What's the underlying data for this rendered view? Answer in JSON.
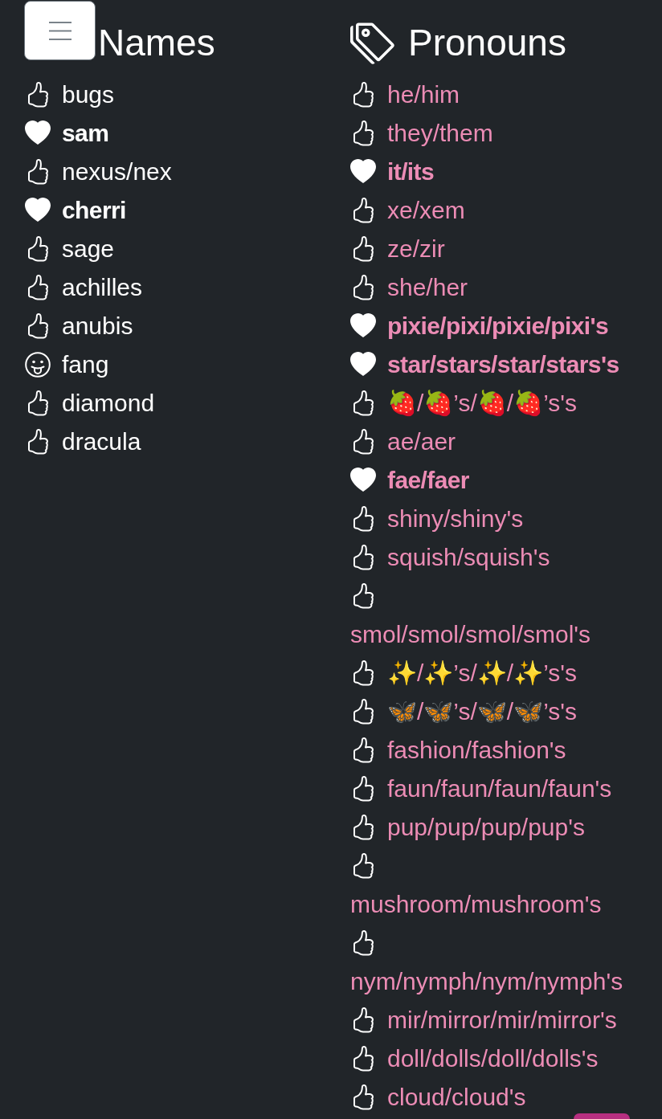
{
  "names": {
    "title": "Names",
    "items": [
      {
        "text": "bugs",
        "kind": "okay"
      },
      {
        "text": "sam",
        "kind": "love"
      },
      {
        "text": "nexus/nex",
        "kind": "okay"
      },
      {
        "text": "cherri",
        "kind": "love"
      },
      {
        "text": "sage",
        "kind": "okay"
      },
      {
        "text": "achilles",
        "kind": "okay"
      },
      {
        "text": "anubis",
        "kind": "okay"
      },
      {
        "text": "fang",
        "kind": "jokingly"
      },
      {
        "text": "diamond",
        "kind": "okay"
      },
      {
        "text": "dracula",
        "kind": "okay"
      }
    ]
  },
  "pronouns": {
    "title": "Pronouns",
    "items": [
      {
        "text": "he/him",
        "kind": "okay"
      },
      {
        "text": "they/them",
        "kind": "okay"
      },
      {
        "text": "it/its",
        "kind": "love"
      },
      {
        "text": "xe/xem",
        "kind": "okay"
      },
      {
        "text": "ze/zir",
        "kind": "okay"
      },
      {
        "text": "she/her",
        "kind": "okay"
      },
      {
        "text": "pixie/pixi/pixie/pixi's",
        "kind": "love"
      },
      {
        "text": "star/stars/star/stars's",
        "kind": "love"
      },
      {
        "text": "🍓/🍓’s/🍓/🍓’s's",
        "kind": "okay"
      },
      {
        "text": "ae/aer",
        "kind": "okay"
      },
      {
        "text": "fae/faer",
        "kind": "love"
      },
      {
        "text": "shiny/shiny's",
        "kind": "okay"
      },
      {
        "text": "squish/squish's",
        "kind": "okay"
      },
      {
        "text": "smol/smol/smol/smol's",
        "kind": "okay"
      },
      {
        "text": "✨/✨’s/✨/✨’s's",
        "kind": "okay"
      },
      {
        "text": "🦋/🦋’s/🦋/🦋’s's",
        "kind": "okay"
      },
      {
        "text": "fashion/fashion's",
        "kind": "okay"
      },
      {
        "text": "faun/faun/faun/faun's",
        "kind": "okay"
      },
      {
        "text": "pup/pup/pup/pup's",
        "kind": "okay"
      },
      {
        "text": "mushroom/mushroom's",
        "kind": "okay"
      },
      {
        "text": "nym/nymph/nym/nymph's",
        "kind": "okay"
      },
      {
        "text": "mir/mirror/mir/mirror's",
        "kind": "okay"
      },
      {
        "text": "doll/dolls/doll/dolls's",
        "kind": "okay"
      },
      {
        "text": "cloud/cloud's",
        "kind": "okay"
      }
    ]
  }
}
